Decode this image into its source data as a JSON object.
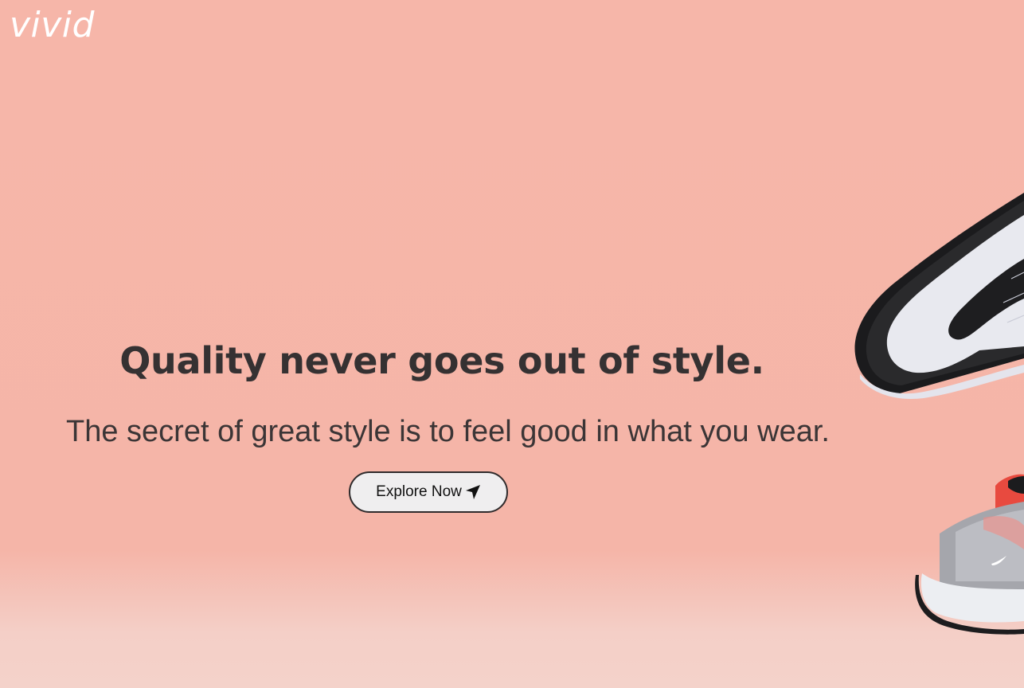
{
  "brand": {
    "logo_text": "vivid"
  },
  "hero": {
    "headline": "Quality never goes out of style.",
    "tagline": "The secret of great style is to feel good in what you wear.",
    "cta_label": "Explore Now",
    "cta_icon": "send-arrow-icon"
  },
  "images": {
    "top": "sneaker-sole-icon",
    "bottom": "sneaker-side-icon"
  },
  "colors": {
    "background": "#f6b6a9",
    "heading_text": "#353132",
    "button_bg": "#efeeef",
    "logo": "#ffffff"
  }
}
